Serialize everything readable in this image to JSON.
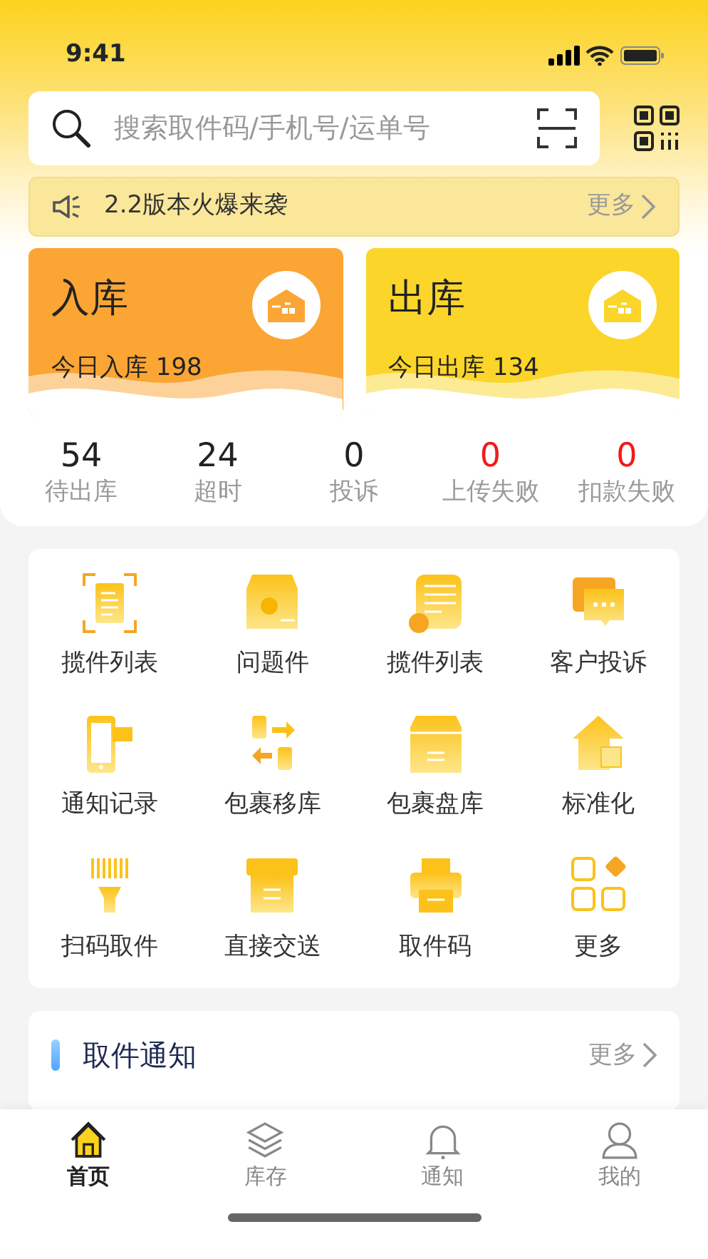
{
  "status_bar": {
    "time": "9:41"
  },
  "search": {
    "placeholder": "搜索取件码/手机号/运单号"
  },
  "notice": {
    "text": "2.2版本火爆来袭",
    "more": "更多"
  },
  "cards": [
    {
      "title": "入库",
      "subtitle": "今日入库 198",
      "color": "#fba535"
    },
    {
      "title": "出库",
      "subtitle": "今日出库 134",
      "color": "#fbd52a"
    }
  ],
  "stats": [
    {
      "value": "54",
      "label": "待出库",
      "alert": false
    },
    {
      "value": "24",
      "label": "超时",
      "alert": false
    },
    {
      "value": "0",
      "label": "投诉",
      "alert": false
    },
    {
      "value": "0",
      "label": "上传失败",
      "alert": true
    },
    {
      "value": "0",
      "label": "扣款失败",
      "alert": true
    }
  ],
  "tools": [
    {
      "label": "揽件列表"
    },
    {
      "label": "问题件"
    },
    {
      "label": "揽件列表"
    },
    {
      "label": "客户投诉"
    },
    {
      "label": "通知记录"
    },
    {
      "label": "包裹移库"
    },
    {
      "label": "包裹盘库"
    },
    {
      "label": "标准化"
    },
    {
      "label": "扫码取件"
    },
    {
      "label": "直接交送"
    },
    {
      "label": "取件码"
    },
    {
      "label": "更多"
    }
  ],
  "pickup_notice": {
    "title": "取件通知",
    "more": "更多"
  },
  "tab_bar": [
    {
      "label": "首页",
      "selected": true
    },
    {
      "label": "库存",
      "selected": false
    },
    {
      "label": "通知",
      "selected": false
    },
    {
      "label": "我的",
      "selected": false
    }
  ]
}
